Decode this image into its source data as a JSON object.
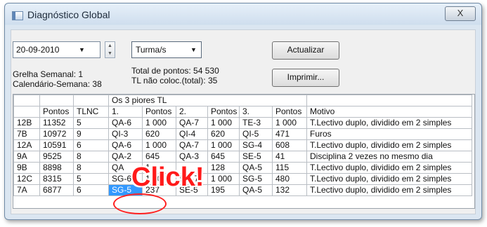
{
  "window": {
    "title": "Diagnóstico Global",
    "close_glyph": "X"
  },
  "toolbar": {
    "date_value": "20-09-2010",
    "turma_value": "Turma/s",
    "actualizar_label": "Actualizar",
    "imprimir_label": "Imprimir..."
  },
  "info": {
    "grelha": "Grelha Semanal: 1",
    "calendario": "Calendário-Semana: 38",
    "total_pontos": "Total de pontos: 54 530",
    "tl_nao_coloc": "TL não coloc.(total): 35"
  },
  "table": {
    "group_header": "Os 3 piores TL",
    "columns": [
      "",
      "Pontos",
      "TLNC",
      "1.",
      "Pontos",
      "2.",
      "Pontos",
      "3.",
      "Pontos",
      "Motivo"
    ],
    "rows": [
      [
        "12B",
        "11352",
        "5",
        "QA-6",
        "1 000",
        "QA-7",
        "1 000",
        "TE-3",
        "1 000",
        "T.Lectivo duplo, dividido em 2 simples"
      ],
      [
        "7B",
        "10972",
        "9",
        "QI-3",
        "620",
        "QI-4",
        "620",
        "QI-5",
        "471",
        "Furos"
      ],
      [
        "12A",
        "10591",
        "6",
        "QA-6",
        "1 000",
        "QA-7",
        "1 000",
        "SG-4",
        "608",
        "T.Lectivo duplo, dividido em 2 simples"
      ],
      [
        "9A",
        "9525",
        "8",
        "QA-2",
        "645",
        "QA-3",
        "645",
        "SE-5",
        "41",
        "Disciplina 2 vezes no mesmo dia"
      ],
      [
        "9B",
        "8898",
        "8",
        "QA",
        "1",
        "",
        "128",
        "QA-5",
        "115",
        "T.Lectivo duplo, dividido em 2 simples"
      ],
      [
        "12C",
        "8315",
        "5",
        "SG-6",
        "1 000",
        "SG-7",
        "1 000",
        "SG-5",
        "480",
        "T.Lectivo duplo, dividido em 2 simples"
      ],
      [
        "7A",
        "6877",
        "6",
        "SG-5",
        "237",
        "SE-5",
        "195",
        "QA-5",
        "132",
        "T.Lectivo duplo, dividido em 2 simples"
      ]
    ],
    "selected": {
      "row": 6,
      "col": 3
    }
  },
  "overlay": {
    "click_text": "Click!"
  },
  "colors": {
    "selection": "#3399ff",
    "overlay_red": "#ff1a1a"
  }
}
